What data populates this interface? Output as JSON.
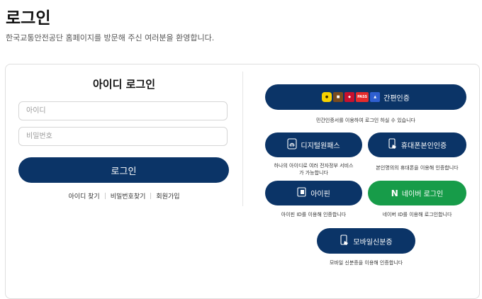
{
  "header": {
    "title": "로그인",
    "subtitle": "한국교통안전공단 홈페이지를 방문해 주신 여러분을 환영합니다."
  },
  "id_login": {
    "heading": "아이디 로그인",
    "id_placeholder": "아이디",
    "password_placeholder": "비밀번호",
    "login_label": "로그인",
    "links": [
      "아이디 찾기",
      "비밀번호찾기",
      "회원가입"
    ]
  },
  "auth_options": {
    "simple_auth": {
      "label": "간편인증",
      "desc": "민간인증서를 이용하여 로그인 하실 수 있습니다",
      "provider_badges": [
        {
          "name": "kakao-badge",
          "color": "#f7d200"
        },
        {
          "name": "badge-2",
          "color": "#7a4b1e"
        },
        {
          "name": "badge-3",
          "color": "#c8102e"
        },
        {
          "name": "pass-badge",
          "text": "PASS",
          "color": "#e52b2b"
        },
        {
          "name": "badge-5",
          "color": "#2f5fd0"
        }
      ]
    },
    "digital_one_pass": {
      "label": "디지털원패스",
      "desc_line1": "하나의 아이디로 여러 전자정부 서비스",
      "desc_line2": "가 가능합니다"
    },
    "mobile_identity": {
      "label": "휴대폰본인인증",
      "desc": "본인명의의 휴대폰을 이용해 인증합니다"
    },
    "ipin": {
      "label": "아이핀",
      "desc": "아이핀 ID를 이용해 인증합니다"
    },
    "naver": {
      "label": "네이버 로그인",
      "desc": "네이버 ID를 이용해 로그인합니다",
      "color": "#179c49"
    },
    "mobile_id": {
      "label": "모바일신분증",
      "desc": "모바일 신분증을 이용해 인증합니다"
    }
  },
  "colors": {
    "primary": "#0b3467",
    "naver_green": "#179c49"
  }
}
